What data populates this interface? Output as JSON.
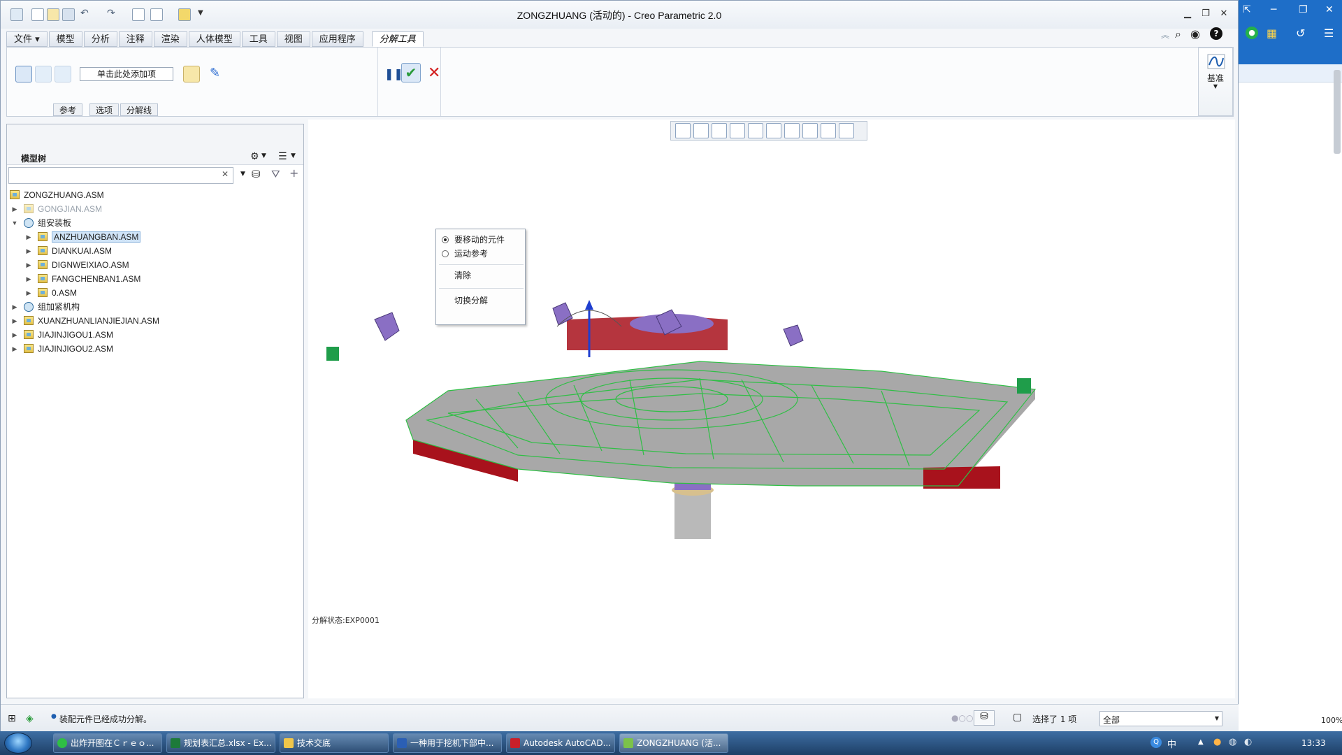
{
  "window": {
    "title": "ZONGZHUANG (活动的) - Creo Parametric 2.0"
  },
  "menu_tabs": [
    {
      "label": "文件 ▾"
    },
    {
      "label": "模型"
    },
    {
      "label": "分析"
    },
    {
      "label": "注释"
    },
    {
      "label": "渲染"
    },
    {
      "label": "人体模型"
    },
    {
      "label": "工具"
    },
    {
      "label": "视图"
    },
    {
      "label": "应用程序"
    },
    {
      "label": "分解工具"
    }
  ],
  "ribbon": {
    "add_item_label": "单击此处添加项",
    "subtabs": [
      "参考",
      "选项",
      "分解线"
    ],
    "datum_label": "基准"
  },
  "model_tree": {
    "title": "模型树",
    "search_value": "",
    "items": [
      {
        "label": "ZONGZHUANG.ASM"
      },
      {
        "label": "GONGJIAN.ASM"
      },
      {
        "label": "组安装板"
      },
      {
        "label": "ANZHUANGBAN.ASM"
      },
      {
        "label": "DIANKUAI.ASM"
      },
      {
        "label": "DIGNWEIXIAO.ASM"
      },
      {
        "label": "FANGCHENBAN1.ASM"
      },
      {
        "label": "0.ASM"
      },
      {
        "label": "组加紧机构"
      },
      {
        "label": "XUANZHUANLIANJIEJIAN.ASM"
      },
      {
        "label": "JIAJINJIGOU1.ASM"
      },
      {
        "label": "JIAJINJIGOU2.ASM"
      }
    ]
  },
  "context_menu": {
    "items": [
      "要移动的元件",
      "运动参考",
      "清除",
      "切换分解"
    ]
  },
  "viewport": {
    "explode_state": "分解状态:EXP0001"
  },
  "statusbar": {
    "message": "装配元件已经成功分解。",
    "selection": "选择了 1 项",
    "filter_value": "全部"
  },
  "taskbar": {
    "buttons": [
      "出炸开图在Ｃｒｅｏ...",
      "规划表汇总.xlsx - Ex...",
      "技术交底",
      "一种用于挖机下部中...",
      "Autodesk AutoCAD...",
      "ZONGZHUANG (活..."
    ],
    "ime": "中",
    "time": "13:33"
  },
  "right_panel": {
    "zoom": "100%"
  },
  "colors": {
    "taskbar": "#2b5280",
    "accent_blue": "#1e6ec8",
    "model_green": "#2fbf45",
    "model_red": "#a8121c",
    "model_purple": "#8a6fc4"
  }
}
